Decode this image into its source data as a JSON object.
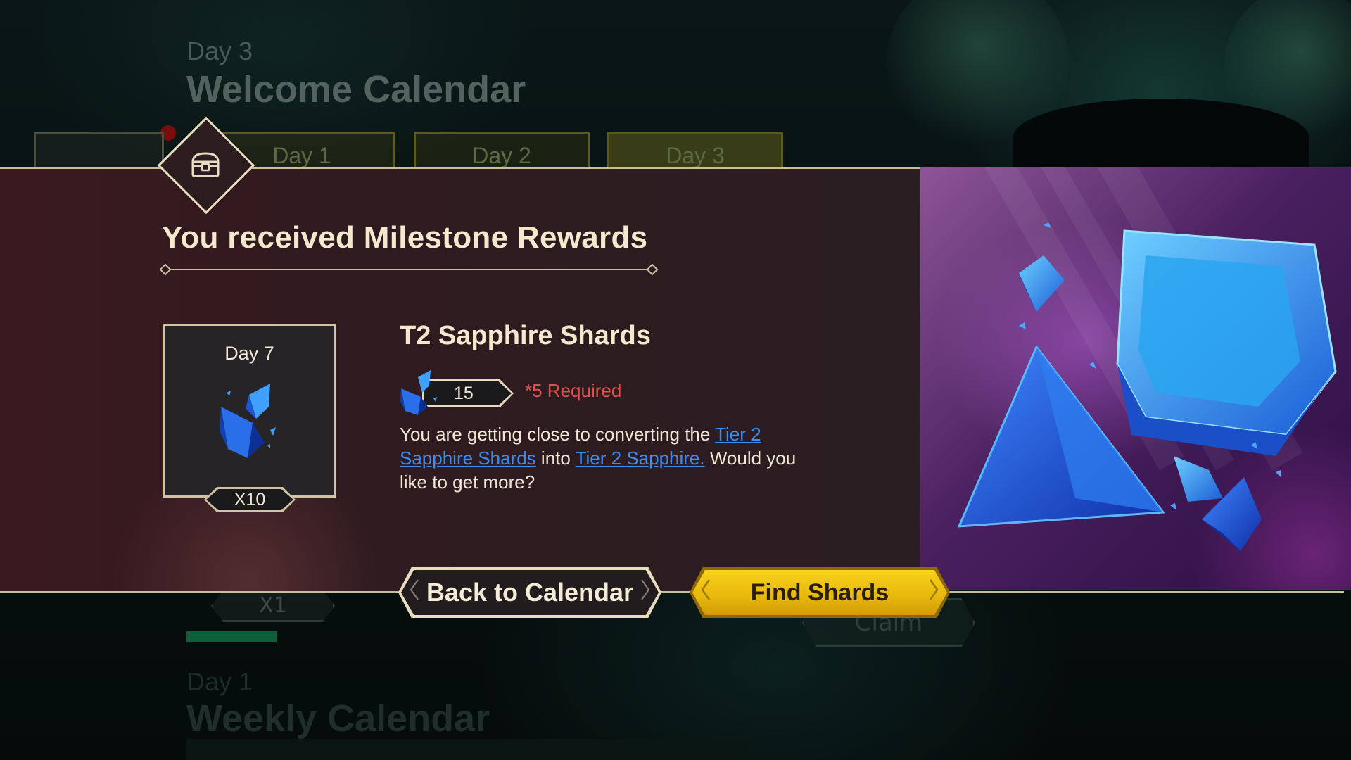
{
  "background": {
    "day_label": "Day 3",
    "calendar_title": "Welcome Calendar",
    "tabs": [
      "Day 1",
      "Day 2",
      "Day 3"
    ],
    "pill_label": "X1",
    "claim_label": "Claim",
    "next_day_label": "Day 1",
    "next_calendar_title": "Weekly Calendar"
  },
  "modal": {
    "emblem_icon": "chest-icon",
    "title": "You received Milestone Rewards",
    "reward": {
      "day": "Day 7",
      "icon": "sapphire-shard-icon",
      "quantity": "X10"
    },
    "item": {
      "name": "T2 Sapphire Shards",
      "owned_count": "15",
      "required_text": "*5 Required",
      "desc_part1": "You are getting close to converting the ",
      "link1": "Tier 2 Sapphire Shards",
      "desc_part2": " into ",
      "link2": "Tier 2 Sapphire.",
      "desc_part3": " Would you like to get more?"
    },
    "buttons": {
      "back": "Back to Calendar",
      "find": "Find Shards"
    }
  },
  "colors": {
    "accent_gold": "#f7d21b",
    "frame": "#cbbf9a",
    "link_blue": "#3d8cf0",
    "required_red": "#e0514c",
    "panel_maroon": "#3b1a1f"
  }
}
